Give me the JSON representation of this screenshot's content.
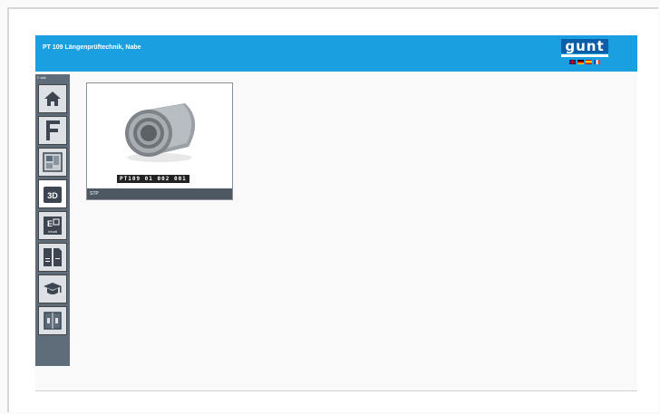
{
  "header": {
    "title": "PT 109 Längenprüftechnik, Nabe",
    "logo_text": "gunt"
  },
  "sidebar": {
    "top_label": "≡ sdz",
    "items": [
      {
        "icon": "home-icon"
      },
      {
        "icon": "caliper-icon"
      },
      {
        "icon": "drawing-icon"
      },
      {
        "icon": "3d-icon",
        "label": "3D",
        "active": true
      },
      {
        "icon": "exercise-icon",
        "label": "E",
        "sublabel": "Inhalt"
      },
      {
        "icon": "worksheet-icon"
      },
      {
        "icon": "graduation-cap-icon"
      },
      {
        "icon": "book-icon"
      }
    ]
  },
  "tile": {
    "code": "PT109 01 002 001",
    "caption": "STP"
  },
  "colors": {
    "header": "#1aa0e0",
    "sidebar": "#5e6b78",
    "logo": "#0d5ea8",
    "caption": "#4d5863"
  }
}
